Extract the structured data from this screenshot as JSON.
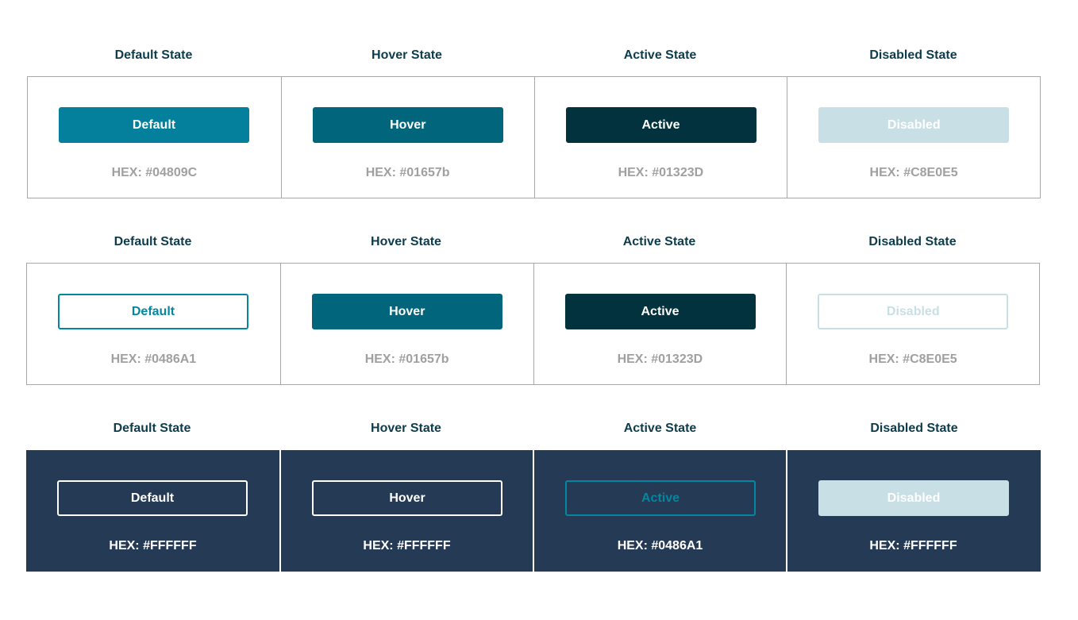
{
  "rows": [
    {
      "labels": [
        "Default State",
        "Hover State",
        "Active State",
        "Disabled State"
      ],
      "buttons": [
        {
          "label": "Default",
          "hex": "HEX: #04809C",
          "bg": "#04809C",
          "border": "#04809C",
          "text": "#ffffff"
        },
        {
          "label": "Hover",
          "hex": "HEX: #01657b",
          "bg": "#01657B",
          "border": "#01657B",
          "text": "#ffffff"
        },
        {
          "label": "Active",
          "hex": "HEX: #01323D",
          "bg": "#01323D",
          "border": "#01323D",
          "text": "#ffffff"
        },
        {
          "label": "Disabled",
          "hex": "HEX: #C8E0E5",
          "bg": "#C8E0E5",
          "border": "#C8E0E5",
          "text": "#ffffff"
        }
      ]
    },
    {
      "labels": [
        "Default State",
        "Hover State",
        "Active State",
        "Disabled State"
      ],
      "buttons": [
        {
          "label": "Default",
          "hex": "HEX: #0486A1",
          "bg": "#ffffff",
          "border": "#0486A1",
          "text": "#0486A1"
        },
        {
          "label": "Hover",
          "hex": "HEX: #01657b",
          "bg": "#01657B",
          "border": "#01657B",
          "text": "#ffffff"
        },
        {
          "label": "Active",
          "hex": "HEX: #01323D",
          "bg": "#01323D",
          "border": "#01323D",
          "text": "#ffffff"
        },
        {
          "label": "Disabled",
          "hex": "HEX: #C8E0E5",
          "bg": "#ffffff",
          "border": "#C8E0E5",
          "text": "#C8E0E5"
        }
      ]
    },
    {
      "labels": [
        "Default State",
        "Hover State",
        "Active State",
        "Disabled State"
      ],
      "buttons": [
        {
          "label": "Default",
          "hex": "HEX: #FFFFFF",
          "bg": "#253A54",
          "border": "#FFFFFF",
          "text": "#ffffff"
        },
        {
          "label": "Hover",
          "hex": "HEX: #FFFFFF",
          "bg": "#253A54",
          "border": "#FFFFFF",
          "text": "#ffffff"
        },
        {
          "label": "Active",
          "hex": "HEX: #0486A1",
          "bg": "#253A54",
          "border": "#0486A1",
          "text": "#0486A1"
        },
        {
          "label": "Disabled",
          "hex": "HEX: #FFFFFF",
          "bg": "#C8E0E5",
          "border": "#C8E0E5",
          "text": "#ffffff"
        }
      ]
    }
  ],
  "colors": {
    "label_text": "#0D3C4C",
    "hex_text_light": "#A0A0A0",
    "hex_text_dark": "#FFFFFF",
    "grid_border": "#A8A8A8",
    "dark_bg": "#253A54"
  }
}
